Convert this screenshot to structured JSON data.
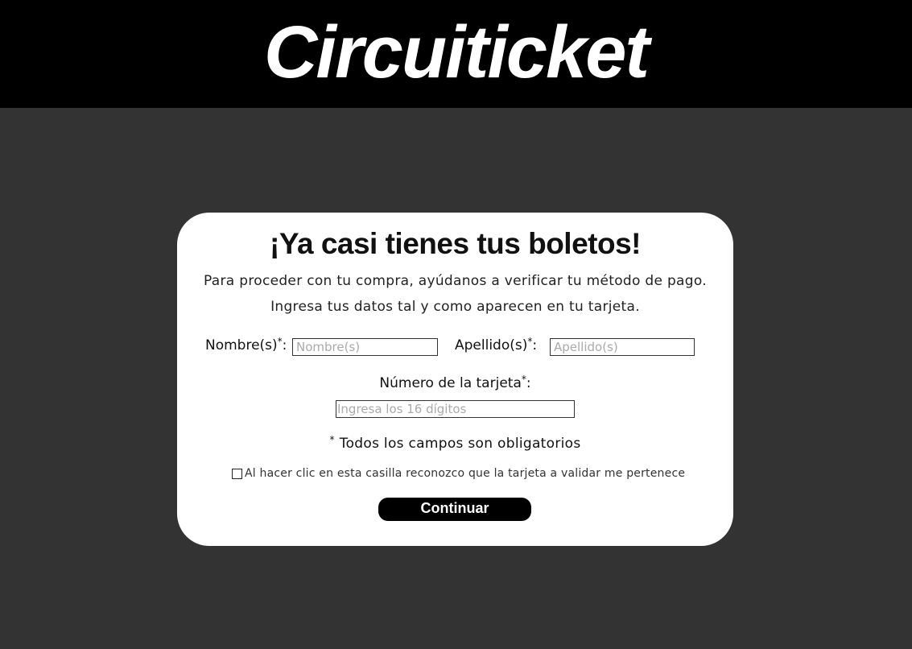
{
  "header": {
    "brand": "Circuiticket"
  },
  "card": {
    "title": "¡Ya casi tienes tus boletos!",
    "intro_line1": "Para proceder con tu compra, ayúdanos a verificar tu método de pago.",
    "intro_line2": "Ingresa tus datos tal y como aparecen en tu tarjeta.",
    "fields": {
      "first_name": {
        "label": "Nombre(s)",
        "required_mark": "*",
        "suffix": ":",
        "value": "",
        "placeholder": "Nombre(s)"
      },
      "last_name": {
        "label": "Apellido(s)",
        "required_mark": "*",
        "suffix": ":",
        "value": "",
        "placeholder": "Apellido(s)"
      },
      "card_number": {
        "label": "Número de la tarjeta",
        "required_mark": "*",
        "suffix": ":",
        "value": "",
        "placeholder": "Ingresa los 16 dígitos"
      }
    },
    "required_note": {
      "mark": "*",
      "text": "Todos los campos son obligatorios"
    },
    "consent": {
      "checked": false,
      "text": "Al hacer clic en esta casilla reconozco que la tarjeta a validar me pertenece"
    },
    "continue_label": "Continuar"
  },
  "colors": {
    "page_background": "#333333",
    "header_background": "#000000",
    "card_background": "#ffffff",
    "button_background": "#000000",
    "button_text": "#ffffff"
  }
}
